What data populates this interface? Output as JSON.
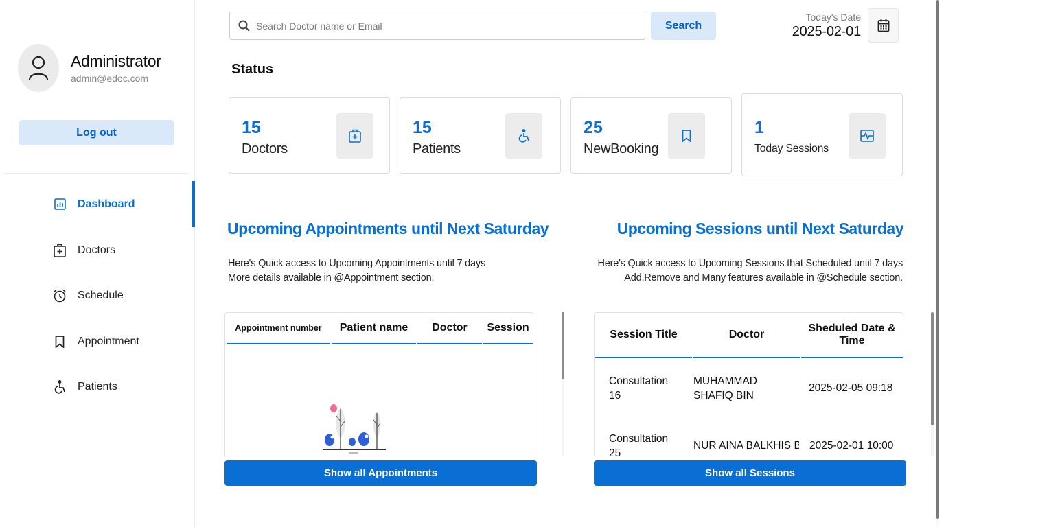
{
  "sidebar": {
    "profile": {
      "name": "Administrator",
      "email": "admin@edoc.com"
    },
    "logout_label": "Log out",
    "nav": [
      {
        "label": "Dashboard",
        "icon": "dashboard-icon",
        "active": true
      },
      {
        "label": "Doctors",
        "icon": "doctor-icon",
        "active": false
      },
      {
        "label": "Schedule",
        "icon": "alarm-clock-icon",
        "active": false
      },
      {
        "label": "Appointment",
        "icon": "bookmark-icon",
        "active": false
      },
      {
        "label": "Patients",
        "icon": "wheelchair-icon",
        "active": false
      }
    ]
  },
  "header": {
    "search_placeholder": "Search Doctor name or Email",
    "search_button": "Search",
    "date_label": "Today's Date",
    "date_value": "2025-02-01"
  },
  "status": {
    "title": "Status",
    "cards": [
      {
        "value": "15",
        "label": "Doctors",
        "icon": "medical-kit-icon"
      },
      {
        "value": "15",
        "label": "Patients",
        "icon": "wheelchair-icon"
      },
      {
        "value": "25",
        "label": "NewBooking",
        "icon": "bookmark-icon"
      },
      {
        "value": "1",
        "label": "Today Sessions",
        "icon": "session-icon"
      }
    ]
  },
  "appointments": {
    "title": "Upcoming Appointments until Next Saturday",
    "desc_line1": "Here's Quick access to Upcoming Appointments until 7 days",
    "desc_line2": "More details available in @Appointment section.",
    "columns": [
      "Appointment number",
      "Patient name",
      "Doctor",
      "Session"
    ],
    "rows": [],
    "button": "Show all Appointments"
  },
  "sessions": {
    "title": "Upcoming Sessions until Next Saturday",
    "desc_line1": "Here's Quick access to Upcoming Sessions that Scheduled until 7 days",
    "desc_line2": "Add,Remove and Many features available in @Schedule section.",
    "columns": [
      "Session Title",
      "Doctor",
      "Sheduled Date & Time"
    ],
    "rows": [
      {
        "title": "Consultation 16",
        "doctor": "MUHAMMAD SHAFIQ BIN",
        "datetime": "2025-02-05 09:18"
      },
      {
        "title": "Consultation 25",
        "doctor": "NUR AINA BALKHIS BI",
        "datetime": "2025-02-01 10:00"
      }
    ],
    "button": "Show all Sessions"
  },
  "colors": {
    "accent": "#0a6fd4",
    "accent_light": "#d9e9f9"
  }
}
